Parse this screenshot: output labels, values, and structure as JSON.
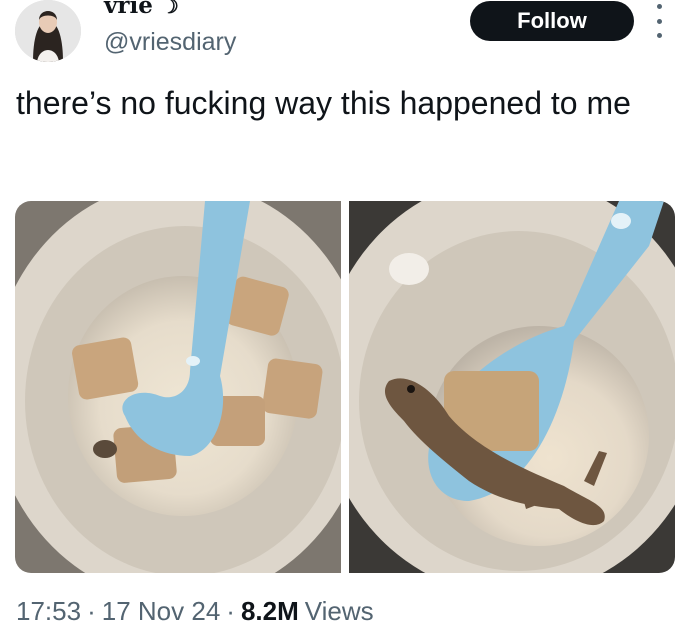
{
  "author": {
    "display_name": "vrie",
    "name_emoji": "☽",
    "handle": "@vriesdiary"
  },
  "actions": {
    "follow_label": "Follow"
  },
  "tweet": {
    "text": "there’s no fucking way this happened to me"
  },
  "meta": {
    "time": "17:53",
    "date": "17 Nov 24",
    "views_count": "8.2M",
    "views_label": "Views",
    "separator": "·"
  },
  "icons": {
    "more": "more-vertical-icon"
  },
  "colors": {
    "follow_bg": "#0f1419",
    "secondary_text": "#536471",
    "spoon": "#8ec3de",
    "bowl": "#e8e2d8",
    "milk": "#efe6d4"
  }
}
